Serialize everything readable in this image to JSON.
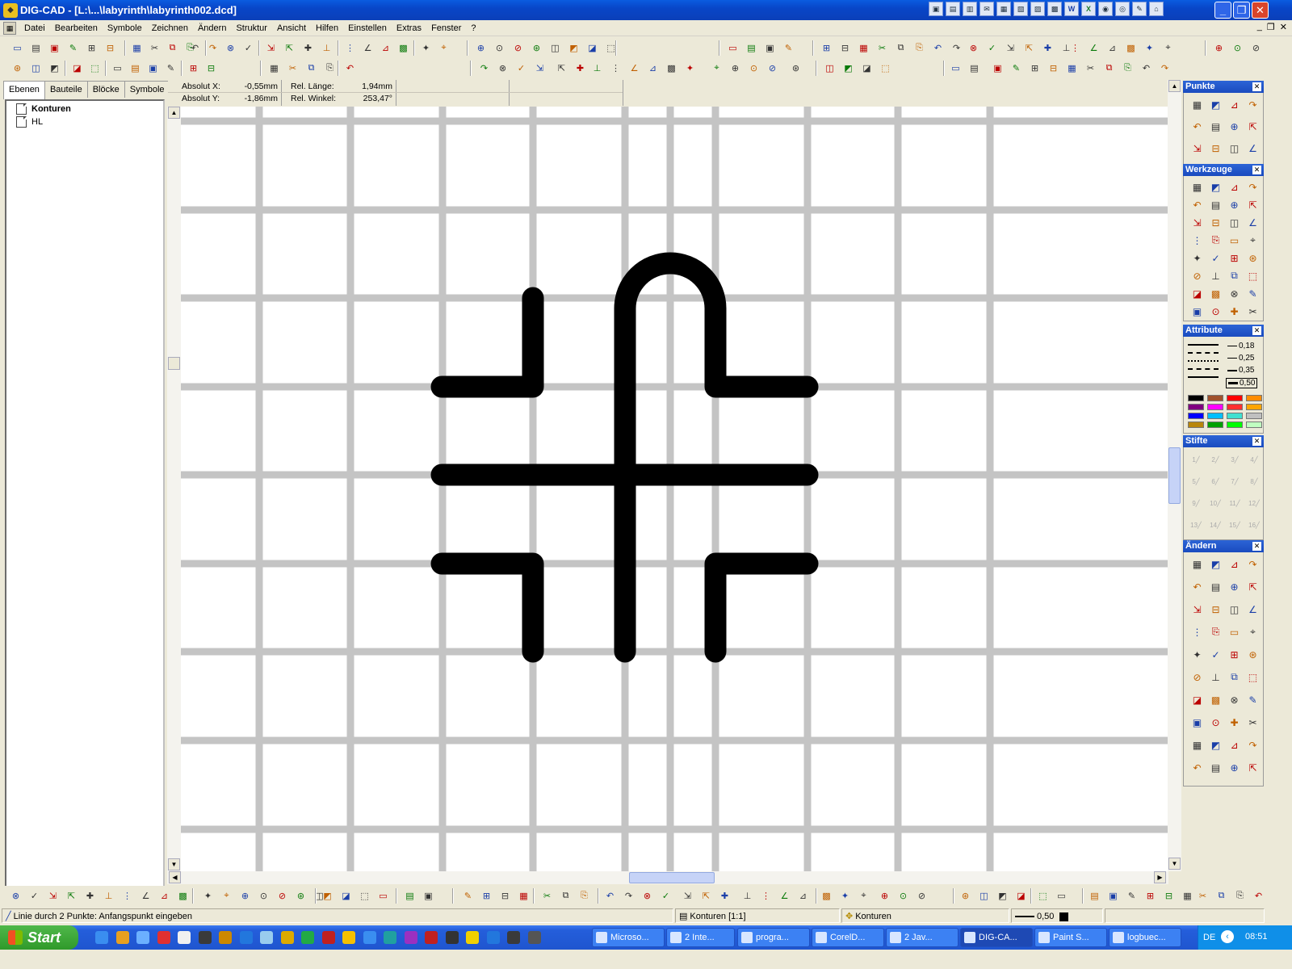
{
  "window": {
    "title": "DIG-CAD - [L:\\...\\labyrinth\\labyrinth002.dcd]",
    "app_icon": "dig-cad-icon"
  },
  "menu": {
    "items": [
      "Datei",
      "Bearbeiten",
      "Symbole",
      "Zeichnen",
      "Ändern",
      "Struktur",
      "Ansicht",
      "Hilfen",
      "Einstellen",
      "Extras",
      "Fenster",
      "?"
    ]
  },
  "left_panel": {
    "tabs": [
      "Ebenen",
      "Bauteile",
      "Blöcke",
      "Symbole"
    ],
    "active_tab": "Ebenen",
    "layers": [
      {
        "name": "Konturen",
        "bold": true
      },
      {
        "name": "HL",
        "bold": false
      }
    ]
  },
  "coords": {
    "abs_x_label": "Absolut X:",
    "abs_x_value": "-0,55mm",
    "abs_y_label": "Absolut Y:",
    "abs_y_value": "-1,86mm",
    "rel_len_label": "Rel. Länge:",
    "rel_len_value": "1,94mm",
    "rel_ang_label": "Rel. Winkel:",
    "rel_ang_value": "253,47°"
  },
  "palettes": {
    "punkte": "Punkte",
    "werkzeuge": "Werkzeuge",
    "attribute": "Attribute",
    "stifte": "Stifte",
    "aendern": "Ändern",
    "line_widths": [
      "0,18",
      "0,25",
      "0,35",
      "0,50"
    ],
    "colors": [
      "#000000",
      "#a0522d",
      "#ff0000",
      "#ff8c00",
      "#800080",
      "#ff00ff",
      "#ff3030",
      "#ffa500",
      "#0000ff",
      "#00bfff",
      "#40e0d0",
      "#c0c0c0",
      "#b8860b",
      "#00a000",
      "#00ff00",
      "#c0ffc0"
    ],
    "pen_labels": [
      "1",
      "2",
      "3",
      "4",
      "5",
      "6",
      "7",
      "8",
      "9",
      "10",
      "11",
      "12",
      "13",
      "14",
      "15",
      "16"
    ]
  },
  "status": {
    "prompt": "Linie durch 2 Punkte: Anfangspunkt eingeben",
    "layer": "Konturen [1:1]",
    "structure": "Konturen",
    "line_width": "0,50"
  },
  "taskbar": {
    "start": "Start",
    "tasks": [
      "Microso...",
      "2 Inte...",
      "progra...",
      "CorelD...",
      "2 Jav...",
      "DIG-CA...",
      "Paint S...",
      "logbuec..."
    ],
    "active_task": "DIG-CA...",
    "lang": "DE",
    "clock": "08:51"
  }
}
